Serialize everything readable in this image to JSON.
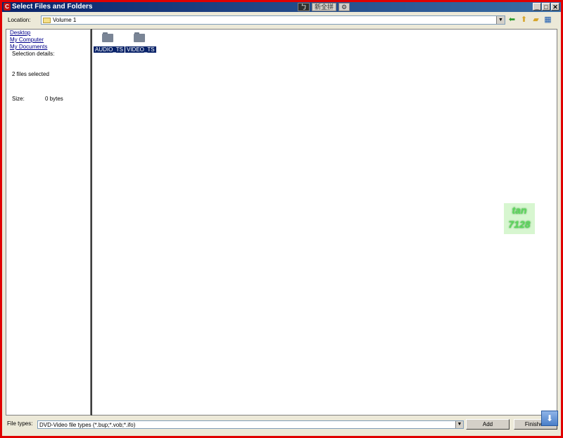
{
  "window": {
    "title": "Select Files and Folders",
    "app_icon_text": "C",
    "ime_buttons": [
      "ㄅ",
      "新全拼",
      "⚙"
    ],
    "controls": [
      "_",
      "□",
      "✕"
    ]
  },
  "location": {
    "label": "Location:",
    "value": "Volume 1",
    "nav_icons": [
      "back-icon",
      "up-folder-icon",
      "new-folder-icon",
      "view-menu-icon"
    ]
  },
  "left_pane": {
    "links": [
      "Desktop",
      "My Computer",
      "My Documents"
    ],
    "selection_details_label": "Selection details:",
    "selection_summary": "2 files selected",
    "size_label": "Size:",
    "size_value": "0 bytes"
  },
  "files": [
    {
      "name": "AUDIO_TS",
      "selected": true
    },
    {
      "name": "VIDEO_TS",
      "selected": true
    }
  ],
  "watermark": {
    "line1": "tan",
    "line2": "7128"
  },
  "bottom": {
    "file_types_label": "File types:",
    "file_types_value": "DVD-Video file types (*.bup;*.vob;*.ifo)",
    "add_label": "Add",
    "finished_label": "Finished"
  },
  "colors": {
    "frame": "#e00000",
    "selection": "#0a246a",
    "link": "#00008b"
  }
}
